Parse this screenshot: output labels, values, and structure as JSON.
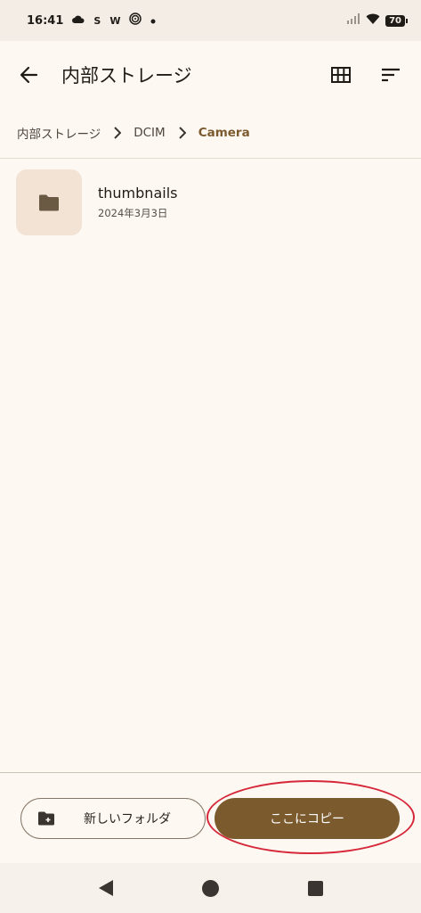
{
  "status_bar": {
    "time": "16:41",
    "notification_glyphs": [
      "S",
      "W"
    ],
    "battery": "70"
  },
  "app_bar": {
    "title": "内部ストレージ"
  },
  "breadcrumb": {
    "items": [
      "内部ストレージ",
      "DCIM",
      "Camera"
    ]
  },
  "files": [
    {
      "name": "thumbnails",
      "date": "2024年3月3日",
      "icon": "folder-icon"
    }
  ],
  "bottom_actions": {
    "new_folder_label": "新しいフォルダ",
    "copy_here_label": "ここにコピー"
  },
  "colors": {
    "accent": "#7b5a2e",
    "background": "#fdf8f1",
    "highlight": "#d6283a"
  }
}
